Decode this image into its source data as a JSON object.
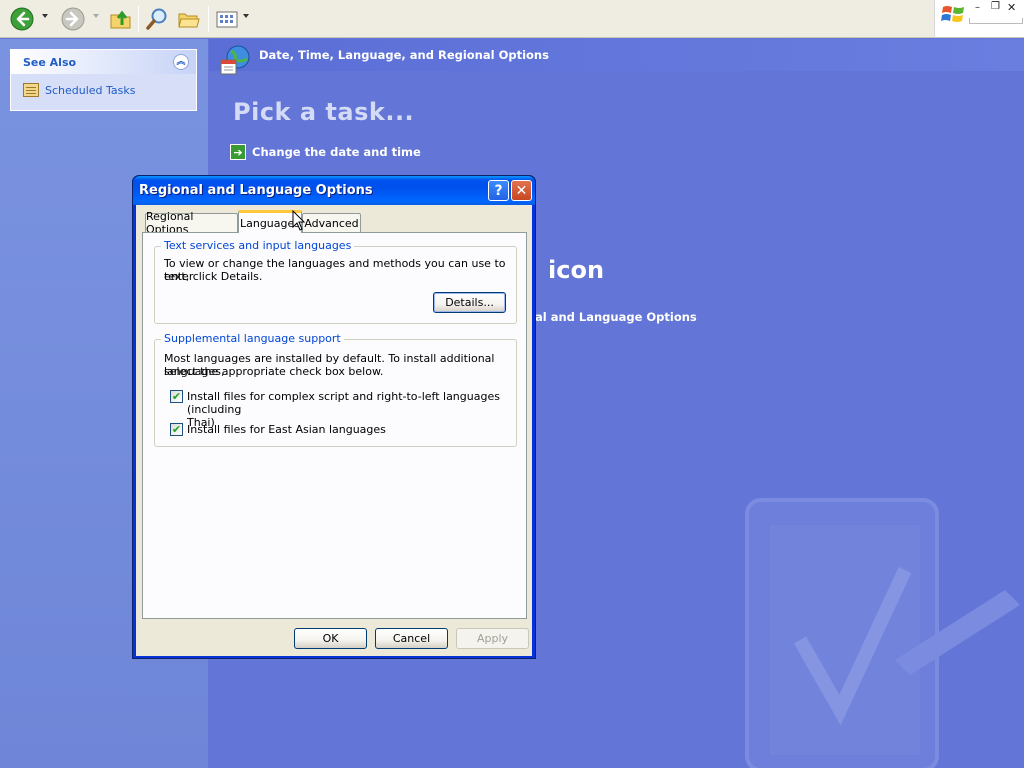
{
  "toolbar": {
    "back_icon": "back-arrow-icon",
    "forward_icon": "forward-arrow-icon",
    "up_icon": "folder-up-icon",
    "search_icon": "search-icon",
    "folders_icon": "folders-icon",
    "views_icon": "views-icon"
  },
  "see_also": {
    "title": "See Also",
    "items": [
      {
        "label": "Scheduled Tasks",
        "icon": "scheduled-tasks-icon"
      }
    ]
  },
  "main": {
    "category_title": "Date, Time, Language, and Regional Options",
    "pick_task_heading": "Pick a task...",
    "tasks": [
      {
        "label": "Change the date and time"
      }
    ],
    "pick_icon_heading_visible": "icon",
    "icon_link_visible": "al and Language Options"
  },
  "dialog": {
    "title": "Regional and Language Options",
    "tabs": [
      {
        "label": "Regional Options",
        "selected": false
      },
      {
        "label": "Languages",
        "selected": true
      },
      {
        "label": "Advanced",
        "selected": false
      }
    ],
    "text_services": {
      "label": "Text services and input languages",
      "description_line1": "To view or change the languages and methods you can use to enter",
      "description_line2": "text, click Details.",
      "details_button": "Details..."
    },
    "supplemental": {
      "label": "Supplemental language support",
      "description_line1": "Most languages are installed by default. To install additional languages,",
      "description_line2": "select the appropriate check box below.",
      "checkboxes": [
        {
          "label_line1": "Install files for complex script and right-to-left languages (including",
          "label_line2": "Thai)",
          "checked": true
        },
        {
          "label_line1": "Install files for East Asian languages",
          "label_line2": "",
          "checked": true
        }
      ]
    },
    "buttons": {
      "ok": "OK",
      "cancel": "Cancel",
      "apply": "Apply"
    }
  },
  "colors": {
    "xp_blue_title": "#0053ee",
    "panel_bg": "#6375d6",
    "dialog_face": "#ece9d8",
    "groupbox_label": "#0046d5",
    "tab_hot": "#ffc83c"
  }
}
